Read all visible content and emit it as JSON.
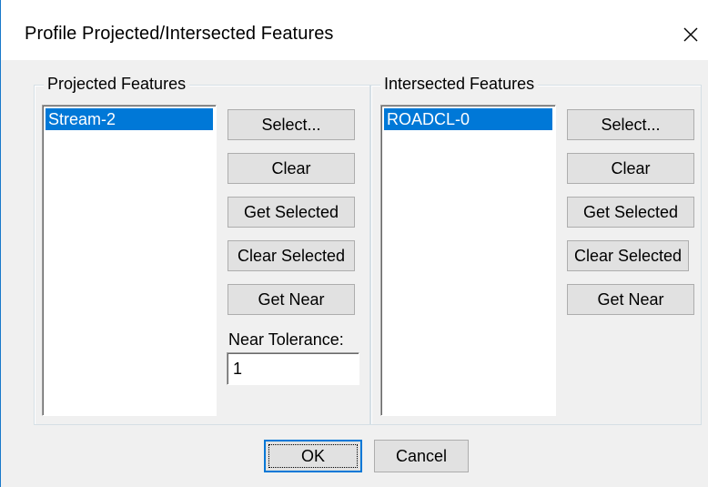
{
  "window": {
    "title": "Profile Projected/Intersected Features",
    "close_icon": "close-icon"
  },
  "projected": {
    "group_label": "Projected Features",
    "items": [
      "Stream-2"
    ],
    "buttons": {
      "select": "Select...",
      "clear": "Clear",
      "get_selected": "Get Selected",
      "clear_selected": "Clear Selected",
      "get_near": "Get Near"
    },
    "tolerance_label": "Near Tolerance:",
    "tolerance_value": "1"
  },
  "intersected": {
    "group_label": "Intersected Features",
    "items": [
      "ROADCL-0"
    ],
    "buttons": {
      "select": "Select...",
      "clear": "Clear",
      "get_selected": "Get Selected",
      "clear_selected": "Clear Selected",
      "get_near": "Get Near"
    }
  },
  "footer": {
    "ok": "OK",
    "cancel": "Cancel"
  },
  "colors": {
    "selection": "#0078d7",
    "button_face": "#e1e1e1",
    "dialog_bg": "#f0f0f0"
  }
}
